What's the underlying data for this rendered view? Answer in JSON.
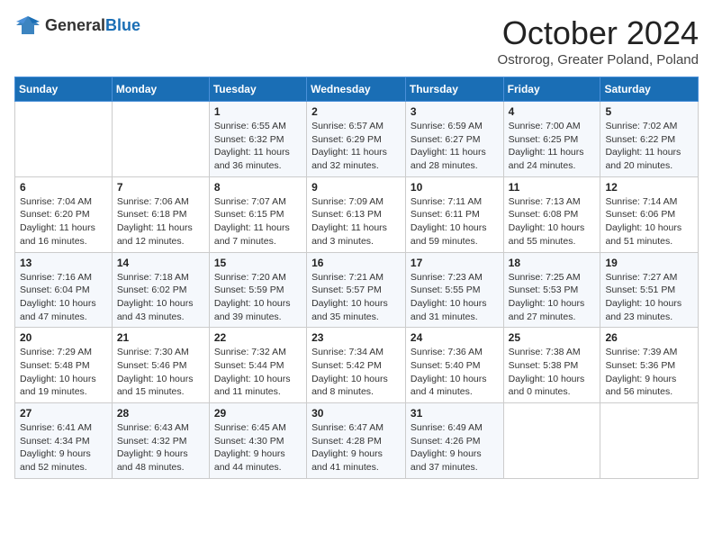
{
  "header": {
    "logo_general": "General",
    "logo_blue": "Blue",
    "month_title": "October 2024",
    "location": "Ostrorog, Greater Poland, Poland"
  },
  "days_of_week": [
    "Sunday",
    "Monday",
    "Tuesday",
    "Wednesday",
    "Thursday",
    "Friday",
    "Saturday"
  ],
  "weeks": [
    [
      {
        "day": "",
        "detail": ""
      },
      {
        "day": "",
        "detail": ""
      },
      {
        "day": "1",
        "detail": "Sunrise: 6:55 AM\nSunset: 6:32 PM\nDaylight: 11 hours\nand 36 minutes."
      },
      {
        "day": "2",
        "detail": "Sunrise: 6:57 AM\nSunset: 6:29 PM\nDaylight: 11 hours\nand 32 minutes."
      },
      {
        "day": "3",
        "detail": "Sunrise: 6:59 AM\nSunset: 6:27 PM\nDaylight: 11 hours\nand 28 minutes."
      },
      {
        "day": "4",
        "detail": "Sunrise: 7:00 AM\nSunset: 6:25 PM\nDaylight: 11 hours\nand 24 minutes."
      },
      {
        "day": "5",
        "detail": "Sunrise: 7:02 AM\nSunset: 6:22 PM\nDaylight: 11 hours\nand 20 minutes."
      }
    ],
    [
      {
        "day": "6",
        "detail": "Sunrise: 7:04 AM\nSunset: 6:20 PM\nDaylight: 11 hours\nand 16 minutes."
      },
      {
        "day": "7",
        "detail": "Sunrise: 7:06 AM\nSunset: 6:18 PM\nDaylight: 11 hours\nand 12 minutes."
      },
      {
        "day": "8",
        "detail": "Sunrise: 7:07 AM\nSunset: 6:15 PM\nDaylight: 11 hours\nand 7 minutes."
      },
      {
        "day": "9",
        "detail": "Sunrise: 7:09 AM\nSunset: 6:13 PM\nDaylight: 11 hours\nand 3 minutes."
      },
      {
        "day": "10",
        "detail": "Sunrise: 7:11 AM\nSunset: 6:11 PM\nDaylight: 10 hours\nand 59 minutes."
      },
      {
        "day": "11",
        "detail": "Sunrise: 7:13 AM\nSunset: 6:08 PM\nDaylight: 10 hours\nand 55 minutes."
      },
      {
        "day": "12",
        "detail": "Sunrise: 7:14 AM\nSunset: 6:06 PM\nDaylight: 10 hours\nand 51 minutes."
      }
    ],
    [
      {
        "day": "13",
        "detail": "Sunrise: 7:16 AM\nSunset: 6:04 PM\nDaylight: 10 hours\nand 47 minutes."
      },
      {
        "day": "14",
        "detail": "Sunrise: 7:18 AM\nSunset: 6:02 PM\nDaylight: 10 hours\nand 43 minutes."
      },
      {
        "day": "15",
        "detail": "Sunrise: 7:20 AM\nSunset: 5:59 PM\nDaylight: 10 hours\nand 39 minutes."
      },
      {
        "day": "16",
        "detail": "Sunrise: 7:21 AM\nSunset: 5:57 PM\nDaylight: 10 hours\nand 35 minutes."
      },
      {
        "day": "17",
        "detail": "Sunrise: 7:23 AM\nSunset: 5:55 PM\nDaylight: 10 hours\nand 31 minutes."
      },
      {
        "day": "18",
        "detail": "Sunrise: 7:25 AM\nSunset: 5:53 PM\nDaylight: 10 hours\nand 27 minutes."
      },
      {
        "day": "19",
        "detail": "Sunrise: 7:27 AM\nSunset: 5:51 PM\nDaylight: 10 hours\nand 23 minutes."
      }
    ],
    [
      {
        "day": "20",
        "detail": "Sunrise: 7:29 AM\nSunset: 5:48 PM\nDaylight: 10 hours\nand 19 minutes."
      },
      {
        "day": "21",
        "detail": "Sunrise: 7:30 AM\nSunset: 5:46 PM\nDaylight: 10 hours\nand 15 minutes."
      },
      {
        "day": "22",
        "detail": "Sunrise: 7:32 AM\nSunset: 5:44 PM\nDaylight: 10 hours\nand 11 minutes."
      },
      {
        "day": "23",
        "detail": "Sunrise: 7:34 AM\nSunset: 5:42 PM\nDaylight: 10 hours\nand 8 minutes."
      },
      {
        "day": "24",
        "detail": "Sunrise: 7:36 AM\nSunset: 5:40 PM\nDaylight: 10 hours\nand 4 minutes."
      },
      {
        "day": "25",
        "detail": "Sunrise: 7:38 AM\nSunset: 5:38 PM\nDaylight: 10 hours\nand 0 minutes."
      },
      {
        "day": "26",
        "detail": "Sunrise: 7:39 AM\nSunset: 5:36 PM\nDaylight: 9 hours\nand 56 minutes."
      }
    ],
    [
      {
        "day": "27",
        "detail": "Sunrise: 6:41 AM\nSunset: 4:34 PM\nDaylight: 9 hours\nand 52 minutes."
      },
      {
        "day": "28",
        "detail": "Sunrise: 6:43 AM\nSunset: 4:32 PM\nDaylight: 9 hours\nand 48 minutes."
      },
      {
        "day": "29",
        "detail": "Sunrise: 6:45 AM\nSunset: 4:30 PM\nDaylight: 9 hours\nand 44 minutes."
      },
      {
        "day": "30",
        "detail": "Sunrise: 6:47 AM\nSunset: 4:28 PM\nDaylight: 9 hours\nand 41 minutes."
      },
      {
        "day": "31",
        "detail": "Sunrise: 6:49 AM\nSunset: 4:26 PM\nDaylight: 9 hours\nand 37 minutes."
      },
      {
        "day": "",
        "detail": ""
      },
      {
        "day": "",
        "detail": ""
      }
    ]
  ]
}
